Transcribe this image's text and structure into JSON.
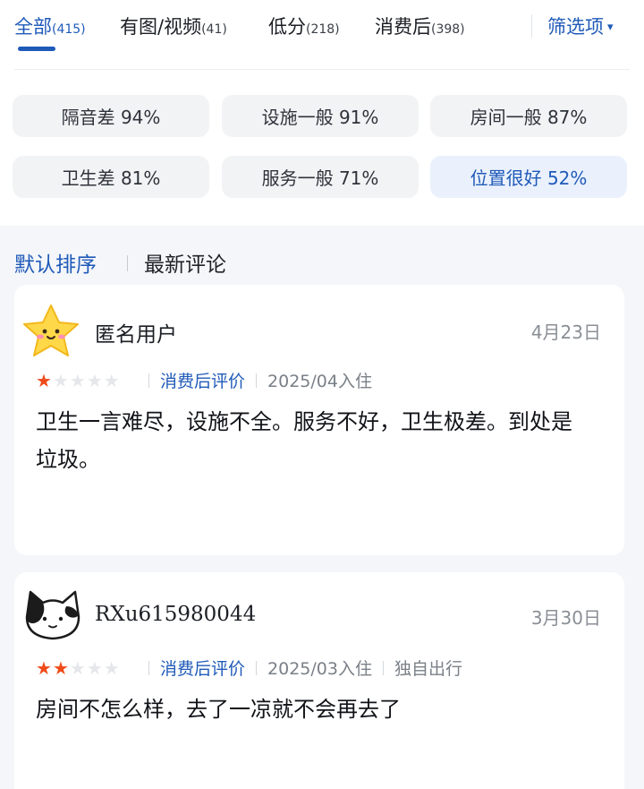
{
  "tabs": [
    {
      "label": "全部",
      "count": "(415)"
    },
    {
      "label": "有图/视频",
      "count": "(41)"
    },
    {
      "label": "低分",
      "count": "(218)"
    },
    {
      "label": "消费后",
      "count": "(398)"
    }
  ],
  "filter": {
    "label": "筛选项",
    "caret": "▾"
  },
  "tags": [
    "隔音差 94%",
    "设施一般 91%",
    "房间一般 87%",
    "卫生差 81%",
    "服务一般 71%",
    "位置很好 52%"
  ],
  "sort": {
    "default": "默认排序",
    "latest": "最新评论"
  },
  "reviews": [
    {
      "user": "匿名用户",
      "date": "4月23日",
      "rating": 1,
      "review_type": "消费后评价",
      "stay": "2025/04入住",
      "trip_type": "",
      "text": "卫生一言难尽，设施不全。服务不好，卫生极差。到处是垃圾。"
    },
    {
      "user": "RXu615980044",
      "date": "3月30日",
      "rating": 2,
      "review_type": "消费后评价",
      "stay": "2025/03入住",
      "trip_type": "独自出行",
      "text": "房间不怎么样，去了一凉就不会再去了"
    }
  ],
  "colors": {
    "accent": "#1f5ab8",
    "star_on": "#ef4b1a",
    "star_off": "#e6e7ea"
  }
}
